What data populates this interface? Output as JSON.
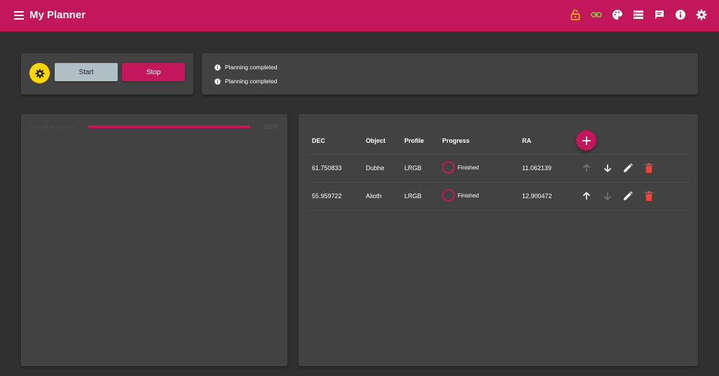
{
  "appbar": {
    "title": "My Planner",
    "accent": "#c2185b",
    "icons": [
      "menu-icon",
      "lock-open-icon",
      "link-icon",
      "palette-icon",
      "storage-icon",
      "feedback-icon",
      "info-icon",
      "settings-icon"
    ]
  },
  "controls": {
    "start_label": "Start",
    "stop_label": "Stop"
  },
  "messages": [
    {
      "text": "Planning completed"
    },
    {
      "text": "Planning completed"
    }
  ],
  "global_progress": {
    "label": "Global progress",
    "value_text": "100%",
    "value": 1.0
  },
  "table": {
    "headers": {
      "dec": "DEC",
      "object": "Object",
      "profile": "Profile",
      "progress": "Progress",
      "ra": "RA"
    },
    "rows": [
      {
        "dec": "61.750833",
        "object": "Dubhe",
        "profile": "LRGB",
        "progress": "Finished",
        "ra": "11.062139"
      },
      {
        "dec": "55.959722",
        "object": "Alioth",
        "profile": "LRGB",
        "progress": "Finished",
        "ra": "12.900472"
      }
    ]
  }
}
